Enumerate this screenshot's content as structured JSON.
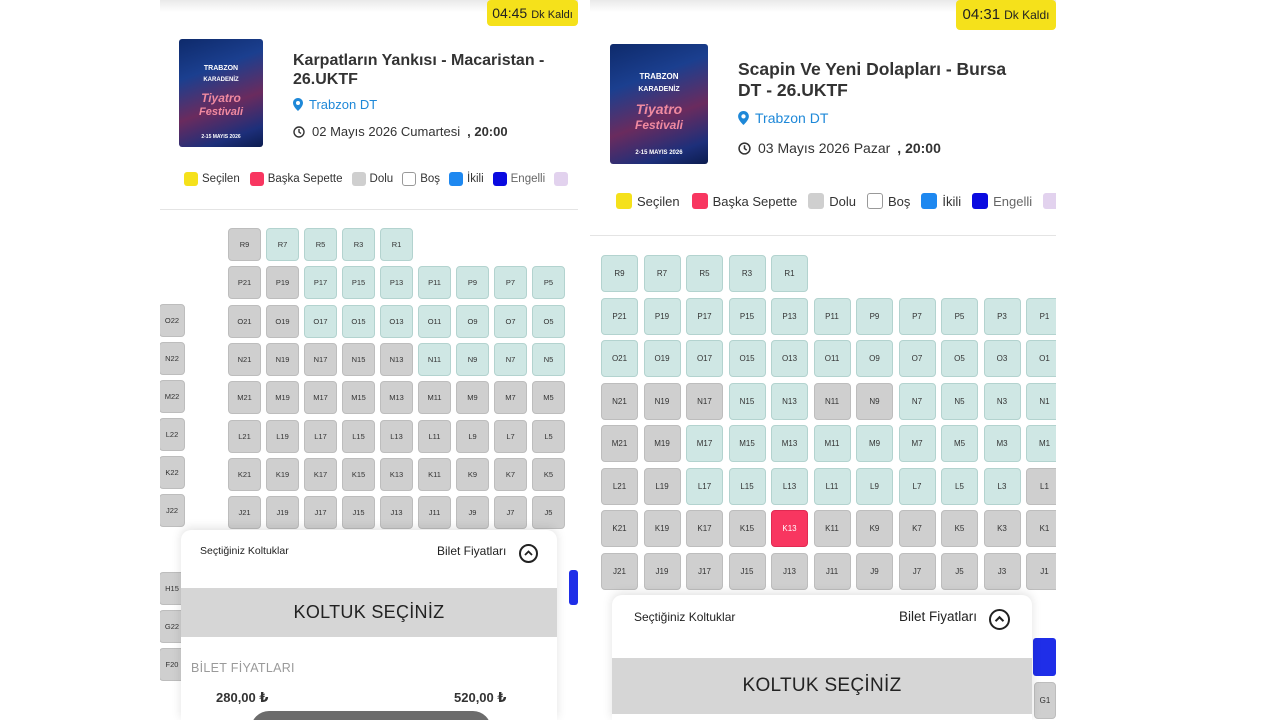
{
  "left": {
    "timer": {
      "time": "04:45",
      "suffix": "Dk Kaldı"
    },
    "event": {
      "title_line1": "Karpatların Yankısı - Macaristan -",
      "title_line2": "26.UKTF",
      "venue": "Trabzon DT",
      "date": "02 Mayıs 2026 Cumartesi",
      "time": ", 20:00"
    },
    "poster": {
      "line1": "TRABZON",
      "line2": "KARADENİZ",
      "line3": "Tiyatro",
      "line4": "Festivali",
      "line5": "2-15 MAYIS 2026"
    },
    "legend": [
      "Seçilen",
      "Başka Sepette",
      "Dolu",
      "Boş",
      "İkili",
      "Engelli"
    ],
    "seat_rows": [
      [
        [
          "R9",
          "f"
        ],
        [
          "R7",
          "e"
        ],
        [
          "R5",
          "e"
        ],
        [
          "R3",
          "e"
        ],
        [
          "R1",
          "e"
        ]
      ],
      [
        [
          "P21",
          "f"
        ],
        [
          "P19",
          "f"
        ],
        [
          "P17",
          "e"
        ],
        [
          "P15",
          "e"
        ],
        [
          "P13",
          "e"
        ],
        [
          "P11",
          "e"
        ],
        [
          "P9",
          "e"
        ],
        [
          "P7",
          "e"
        ],
        [
          "P5",
          "e"
        ]
      ],
      [
        [
          "O21",
          "f"
        ],
        [
          "O19",
          "f"
        ],
        [
          "O17",
          "e"
        ],
        [
          "O15",
          "e"
        ],
        [
          "O13",
          "e"
        ],
        [
          "O11",
          "e"
        ],
        [
          "O9",
          "e"
        ],
        [
          "O7",
          "e"
        ],
        [
          "O5",
          "e"
        ]
      ],
      [
        [
          "N21",
          "f"
        ],
        [
          "N19",
          "f"
        ],
        [
          "N17",
          "f"
        ],
        [
          "N15",
          "f"
        ],
        [
          "N13",
          "f"
        ],
        [
          "N11",
          "e"
        ],
        [
          "N9",
          "e"
        ],
        [
          "N7",
          "e"
        ],
        [
          "N5",
          "e"
        ]
      ],
      [
        [
          "M21",
          "f"
        ],
        [
          "M19",
          "f"
        ],
        [
          "M17",
          "f"
        ],
        [
          "M15",
          "f"
        ],
        [
          "M13",
          "f"
        ],
        [
          "M11",
          "f"
        ],
        [
          "M9",
          "f"
        ],
        [
          "M7",
          "f"
        ],
        [
          "M5",
          "f"
        ]
      ],
      [
        [
          "L21",
          "f"
        ],
        [
          "L19",
          "f"
        ],
        [
          "L17",
          "f"
        ],
        [
          "L15",
          "f"
        ],
        [
          "L13",
          "f"
        ],
        [
          "L11",
          "f"
        ],
        [
          "L9",
          "f"
        ],
        [
          "L7",
          "f"
        ],
        [
          "L5",
          "f"
        ]
      ],
      [
        [
          "K21",
          "f"
        ],
        [
          "K19",
          "f"
        ],
        [
          "K17",
          "f"
        ],
        [
          "K15",
          "f"
        ],
        [
          "K13",
          "f"
        ],
        [
          "K11",
          "f"
        ],
        [
          "K9",
          "f"
        ],
        [
          "K7",
          "f"
        ],
        [
          "K5",
          "f"
        ]
      ],
      [
        [
          "J21",
          "f"
        ],
        [
          "J19",
          "f"
        ],
        [
          "J17",
          "f"
        ],
        [
          "J15",
          "f"
        ],
        [
          "J13",
          "f"
        ],
        [
          "J11",
          "f"
        ],
        [
          "J9",
          "f"
        ],
        [
          "J7",
          "f"
        ],
        [
          "J5",
          "f"
        ]
      ]
    ],
    "side_seats": [
      "O22",
      "N22",
      "M22",
      "L22",
      "K22",
      "J22",
      "H15",
      "G22",
      "F20"
    ],
    "sheet": {
      "selected_label": "Seçtiğiniz Koltuklar",
      "prices_toggle": "Bilet Fiyatları",
      "button": "KOLTUK SEÇİNİZ",
      "prices_title": "BİLET FİYATLARI",
      "price1": "280,00 ₺",
      "price2": "520,00 ₺"
    }
  },
  "right": {
    "timer": {
      "time": "04:31",
      "suffix": "Dk Kaldı"
    },
    "event": {
      "title_line1": "Scapin Ve Yeni Dolapları - Bursa",
      "title_line2": "DT - 26.UKTF",
      "venue": "Trabzon DT",
      "date": "03 Mayıs 2026 Pazar",
      "time": ", 20:00"
    },
    "poster": {
      "line1": "TRABZON",
      "line2": "KARADENİZ",
      "line3": "Tiyatro",
      "line4": "Festivali",
      "line5": "2-15 MAYIS 2026"
    },
    "legend": [
      "Seçilen",
      "Başka Sepette",
      "Dolu",
      "Boş",
      "İkili",
      "Engelli"
    ],
    "seat_rows": [
      [
        [
          "R9",
          "e"
        ],
        [
          "R7",
          "e"
        ],
        [
          "R5",
          "e"
        ],
        [
          "R3",
          "e"
        ],
        [
          "R1",
          "e"
        ]
      ],
      [
        [
          "P21",
          "e"
        ],
        [
          "P19",
          "e"
        ],
        [
          "P17",
          "e"
        ],
        [
          "P15",
          "e"
        ],
        [
          "P13",
          "e"
        ],
        [
          "P11",
          "e"
        ],
        [
          "P9",
          "e"
        ],
        [
          "P7",
          "e"
        ],
        [
          "P5",
          "e"
        ],
        [
          "P3",
          "e"
        ],
        [
          "P1",
          "e"
        ]
      ],
      [
        [
          "O21",
          "e"
        ],
        [
          "O19",
          "e"
        ],
        [
          "O17",
          "e"
        ],
        [
          "O15",
          "e"
        ],
        [
          "O13",
          "e"
        ],
        [
          "O11",
          "e"
        ],
        [
          "O9",
          "e"
        ],
        [
          "O7",
          "e"
        ],
        [
          "O5",
          "e"
        ],
        [
          "O3",
          "e"
        ],
        [
          "O1",
          "e"
        ]
      ],
      [
        [
          "N21",
          "f"
        ],
        [
          "N19",
          "f"
        ],
        [
          "N17",
          "f"
        ],
        [
          "N15",
          "e"
        ],
        [
          "N13",
          "e"
        ],
        [
          "N11",
          "f"
        ],
        [
          "N9",
          "f"
        ],
        [
          "N7",
          "e"
        ],
        [
          "N5",
          "e"
        ],
        [
          "N3",
          "e"
        ],
        [
          "N1",
          "e"
        ]
      ],
      [
        [
          "M21",
          "f"
        ],
        [
          "M19",
          "f"
        ],
        [
          "M17",
          "e"
        ],
        [
          "M15",
          "e"
        ],
        [
          "M13",
          "e"
        ],
        [
          "M11",
          "e"
        ],
        [
          "M9",
          "e"
        ],
        [
          "M7",
          "e"
        ],
        [
          "M5",
          "e"
        ],
        [
          "M3",
          "e"
        ],
        [
          "M1",
          "e"
        ]
      ],
      [
        [
          "L21",
          "f"
        ],
        [
          "L19",
          "f"
        ],
        [
          "L17",
          "e"
        ],
        [
          "L15",
          "e"
        ],
        [
          "L13",
          "e"
        ],
        [
          "L11",
          "e"
        ],
        [
          "L9",
          "e"
        ],
        [
          "L7",
          "e"
        ],
        [
          "L5",
          "e"
        ],
        [
          "L3",
          "e"
        ],
        [
          "L1",
          "f"
        ]
      ],
      [
        [
          "K21",
          "f"
        ],
        [
          "K19",
          "f"
        ],
        [
          "K17",
          "f"
        ],
        [
          "K15",
          "f"
        ],
        [
          "K13",
          "o"
        ],
        [
          "K11",
          "f"
        ],
        [
          "K9",
          "f"
        ],
        [
          "K7",
          "f"
        ],
        [
          "K5",
          "f"
        ],
        [
          "K3",
          "f"
        ],
        [
          "K1",
          "f"
        ]
      ],
      [
        [
          "J21",
          "f"
        ],
        [
          "J19",
          "f"
        ],
        [
          "J17",
          "f"
        ],
        [
          "J15",
          "f"
        ],
        [
          "J13",
          "f"
        ],
        [
          "J11",
          "f"
        ],
        [
          "J9",
          "f"
        ],
        [
          "J7",
          "f"
        ],
        [
          "J5",
          "f"
        ],
        [
          "J3",
          "f"
        ],
        [
          "J1",
          "f"
        ]
      ]
    ],
    "side_seats": [
      "G1"
    ],
    "sheet": {
      "selected_label": "Seçtiğiniz Koltuklar",
      "prices_toggle": "Bilet Fiyatları",
      "button": "KOLTUK SEÇİNİZ"
    }
  },
  "colors": {
    "legend": [
      "#f5e11b",
      "#f83660",
      "#cfcfcf",
      "#ffffff",
      "#1e88f0",
      "#0a0ae0",
      "#e2d2ee"
    ],
    "seat_empty": "#cfe7e4",
    "seat_full": "#cfcfcf",
    "seat_other_cart": "#f83660",
    "timer": "#f5e11b"
  }
}
